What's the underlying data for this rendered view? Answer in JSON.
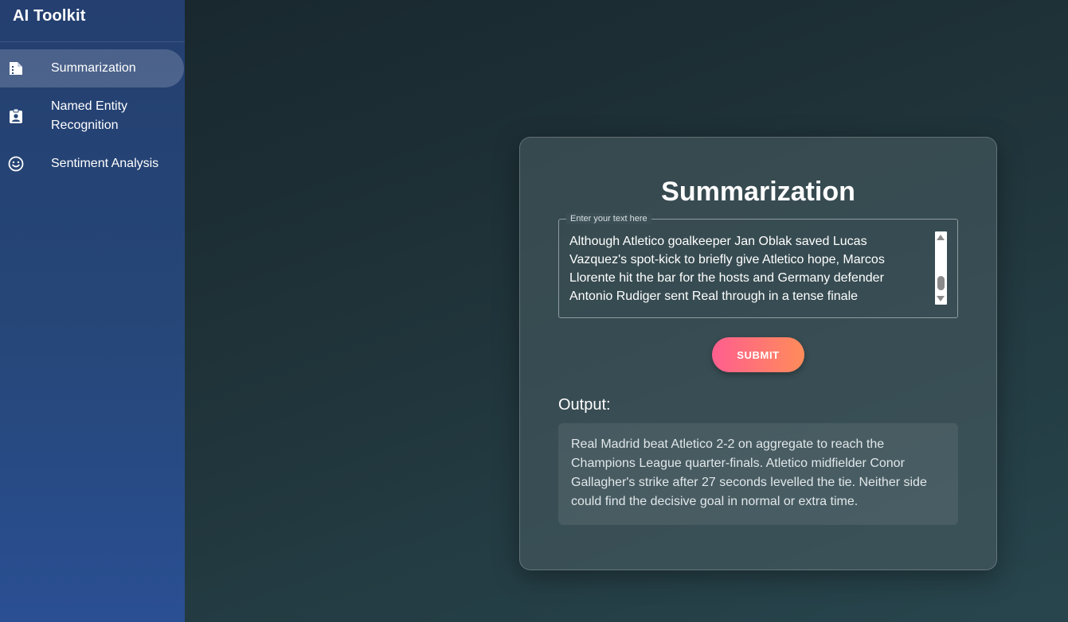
{
  "app": {
    "title": "AI Toolkit"
  },
  "sidebar": {
    "items": [
      {
        "label": "Summarization",
        "icon": "summarize-doc-icon",
        "active": true
      },
      {
        "label": "Named Entity Recognition",
        "icon": "badge-icon",
        "active": false
      },
      {
        "label": "Sentiment Analysis",
        "icon": "smiley-icon",
        "active": false
      }
    ]
  },
  "main": {
    "title": "Summarization",
    "input": {
      "label": "Enter your text here",
      "value": "Although Atletico goalkeeper Jan Oblak saved Lucas Vazquez's spot-kick to briefly give Atletico hope, Marcos Llorente hit the bar for the hosts and Germany defender Antonio Rudiger sent Real through in a tense finale"
    },
    "submit_label": "SUBMIT",
    "output_label": "Output:",
    "output_text": "Real Madrid beat Atletico 2-2 on aggregate to reach the Champions League quarter-finals. Atletico midfielder Conor Gallagher's strike after 27 seconds levelled the tie. Neither side could find the decisive goal in normal or extra time."
  },
  "colors": {
    "sidebar_top": "#243f70",
    "sidebar_bottom": "#2a4f93",
    "background": "#1f3339",
    "submit_gradient_start": "#ff5e8e",
    "submit_gradient_end": "#ff8c5a"
  }
}
